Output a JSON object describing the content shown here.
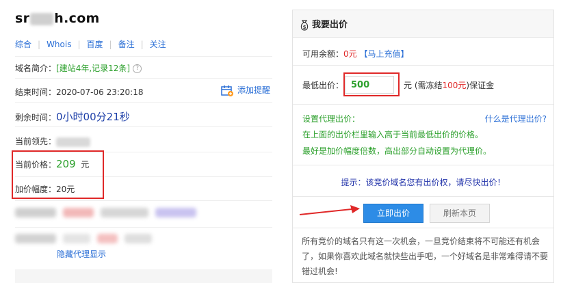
{
  "domain": {
    "prefix": "sr",
    "suffix": "h.com"
  },
  "links": [
    "综合",
    "Whois",
    "百度",
    "备注",
    "关注"
  ],
  "intro": {
    "label": "域名简介：",
    "value": "[建站4年,记录12条]",
    "help_icon": "question-circle-icon"
  },
  "end_time": {
    "label": "结束时间：",
    "value": "2020-07-06 23:20:18"
  },
  "reminder": {
    "label": "添加提醒",
    "icon": "calendar-add-icon"
  },
  "remaining": {
    "label": "剩余时间：",
    "value": "0小时00分21秒"
  },
  "leader": {
    "label": "当前领先："
  },
  "current_price": {
    "label": "当前价格：",
    "value": "209",
    "unit": "元"
  },
  "increment": {
    "label": "加价幅度：",
    "value": "20元"
  },
  "hide_proxy": "隐藏代理显示",
  "panel": {
    "title": "我要出价",
    "title_icon": "money-bag-icon",
    "balance_label": "可用余额：",
    "balance_value": "0元",
    "recharge": "【马上充值】",
    "min_bid_label": "最低出价：",
    "min_bid_value": "500",
    "deposit_prefix": "元 (需冻结",
    "deposit_amount": "100元",
    "deposit_suffix": ")保证金",
    "proxy_label": "设置代理出价：",
    "proxy_question": "什么是代理出价?",
    "proxy_line1": "在上面的出价栏里输入高于当前最低出价的价格。",
    "proxy_line2": "最好是加价幅度倍数，高出部分自动设置为代理价。",
    "tip": "提示：该竞价域名您有出价权，请尽快出价！",
    "bid_button": "立即出价",
    "refresh_button": "刷新本页",
    "notice": "所有竞价的域名只有这一次机会，一旦竞价结束将不可能还有机会了，如果你喜欢此域名就快些出手吧，一个好域名是非常难得请不要错过机会!"
  },
  "colors": {
    "link": "#2b6fd6",
    "green": "#2ca02c",
    "red": "#e02828",
    "button": "#2d8ce6"
  }
}
